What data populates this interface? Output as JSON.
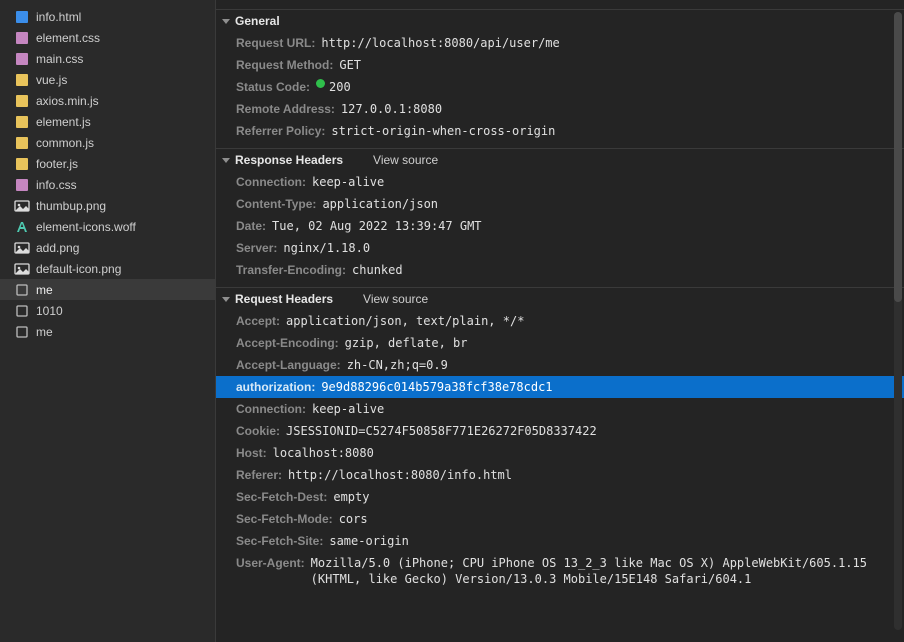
{
  "files": [
    {
      "name": "info.html",
      "icon": "html-icon",
      "selected": false
    },
    {
      "name": "element.css",
      "icon": "css-icon",
      "selected": false
    },
    {
      "name": "main.css",
      "icon": "css-icon",
      "selected": false
    },
    {
      "name": "vue.js",
      "icon": "js-icon",
      "selected": false
    },
    {
      "name": "axios.min.js",
      "icon": "js-icon",
      "selected": false
    },
    {
      "name": "element.js",
      "icon": "js-icon",
      "selected": false
    },
    {
      "name": "common.js",
      "icon": "js-icon",
      "selected": false
    },
    {
      "name": "footer.js",
      "icon": "js-icon",
      "selected": false
    },
    {
      "name": "info.css",
      "icon": "css-icon",
      "selected": false
    },
    {
      "name": "thumbup.png",
      "icon": "image-icon",
      "selected": false
    },
    {
      "name": "element-icons.woff",
      "icon": "font-icon",
      "selected": false
    },
    {
      "name": "add.png",
      "icon": "image-icon",
      "selected": false
    },
    {
      "name": "default-icon.png",
      "icon": "image-icon",
      "selected": false
    },
    {
      "name": "me",
      "icon": "xhr-icon",
      "selected": true
    },
    {
      "name": "1010",
      "icon": "xhr-icon",
      "selected": false
    },
    {
      "name": "me",
      "icon": "xhr-icon",
      "selected": false
    }
  ],
  "sections": {
    "general": {
      "title": "General",
      "rows": [
        {
          "k": "Request URL:",
          "v": "http://localhost:8080/api/user/me"
        },
        {
          "k": "Request Method:",
          "v": "GET"
        },
        {
          "k": "Status Code:",
          "v": "200",
          "status_dot": true
        },
        {
          "k": "Remote Address:",
          "v": "127.0.0.1:8080"
        },
        {
          "k": "Referrer Policy:",
          "v": "strict-origin-when-cross-origin"
        }
      ]
    },
    "response_headers": {
      "title": "Response Headers",
      "view_source": "View source",
      "rows": [
        {
          "k": "Connection:",
          "v": "keep-alive"
        },
        {
          "k": "Content-Type:",
          "v": "application/json"
        },
        {
          "k": "Date:",
          "v": "Tue, 02 Aug 2022 13:39:47 GMT"
        },
        {
          "k": "Server:",
          "v": "nginx/1.18.0"
        },
        {
          "k": "Transfer-Encoding:",
          "v": "chunked"
        }
      ]
    },
    "request_headers": {
      "title": "Request Headers",
      "view_source": "View source",
      "rows": [
        {
          "k": "Accept:",
          "v": "application/json, text/plain, */*"
        },
        {
          "k": "Accept-Encoding:",
          "v": "gzip, deflate, br"
        },
        {
          "k": "Accept-Language:",
          "v": "zh-CN,zh;q=0.9"
        },
        {
          "k": "authorization:",
          "v": "9e9d88296c014b579a38fcf38e78cdc1",
          "highlight": true
        },
        {
          "k": "Connection:",
          "v": "keep-alive"
        },
        {
          "k": "Cookie:",
          "v": "JSESSIONID=C5274F50858F771E26272F05D8337422"
        },
        {
          "k": "Host:",
          "v": "localhost:8080"
        },
        {
          "k": "Referer:",
          "v": "http://localhost:8080/info.html"
        },
        {
          "k": "Sec-Fetch-Dest:",
          "v": "empty"
        },
        {
          "k": "Sec-Fetch-Mode:",
          "v": "cors"
        },
        {
          "k": "Sec-Fetch-Site:",
          "v": "same-origin"
        },
        {
          "k": "User-Agent:",
          "v": "Mozilla/5.0 (iPhone; CPU iPhone OS 13_2_3 like Mac OS X) AppleWebKit/605.1.15 (KHTML, like Gecko) Version/13.0.3 Mobile/15E148 Safari/604.1"
        }
      ]
    }
  },
  "icon_colors": {
    "html-icon": "ic-blue",
    "css-icon": "ic-purple",
    "js-icon": "ic-yellow",
    "image-icon": "ic-white",
    "font-icon": "ic-teal",
    "xhr-icon": "ic-white"
  }
}
